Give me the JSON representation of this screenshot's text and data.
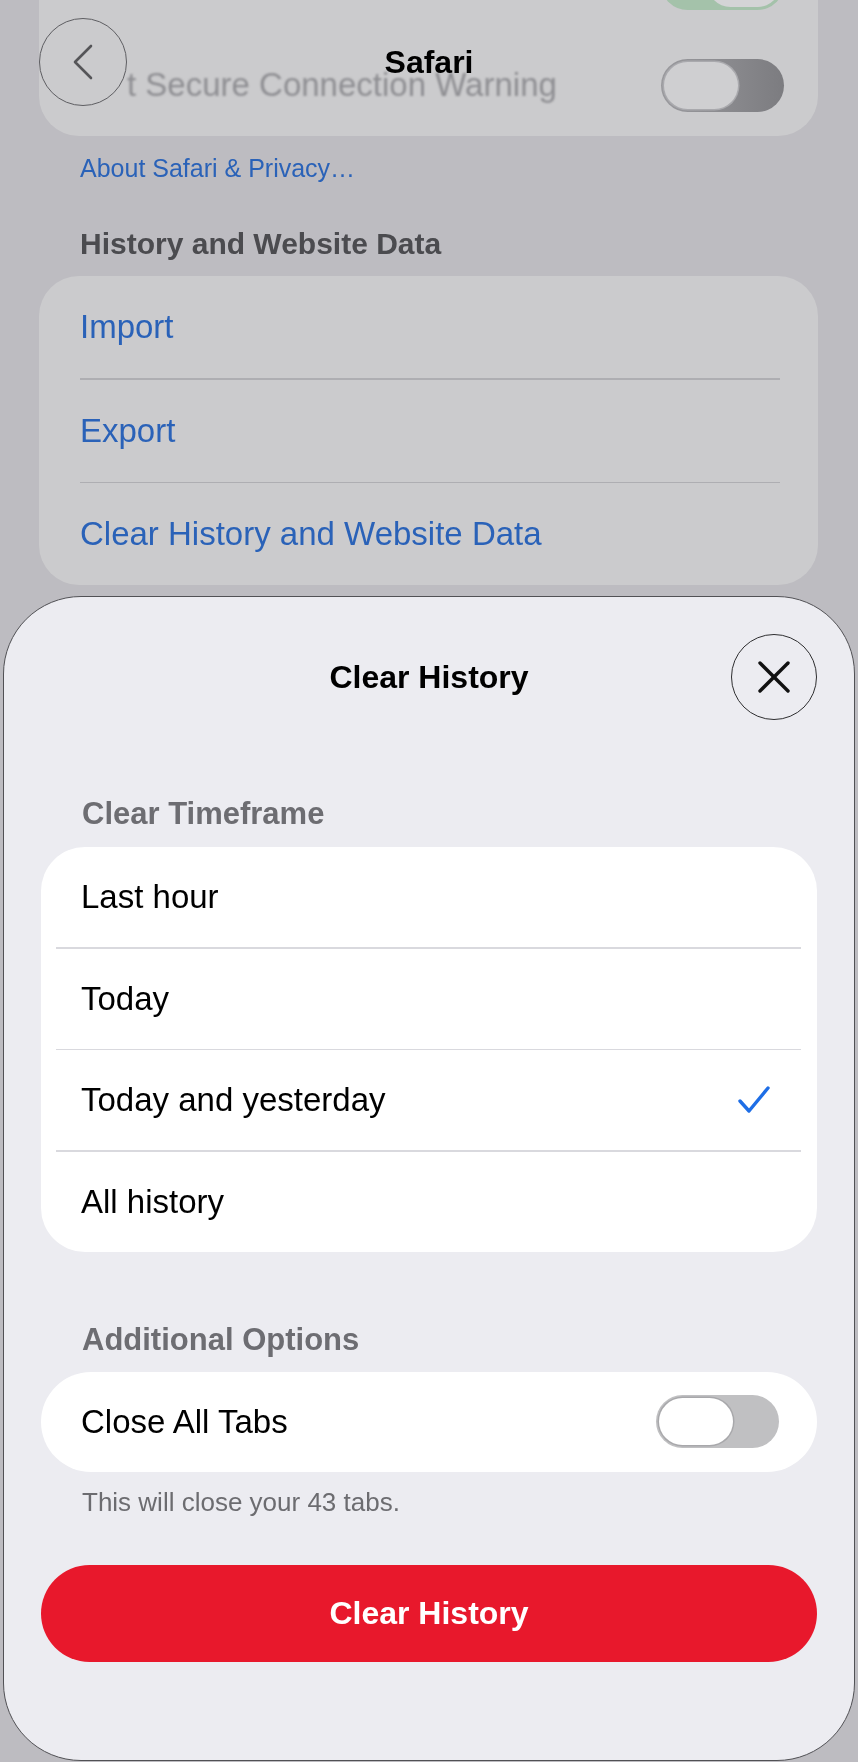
{
  "nav": {
    "title": "Safari"
  },
  "background": {
    "top_card": {
      "rows": [
        {
          "on": true
        },
        {
          "label": "t Secure Connection Warning",
          "on": false
        }
      ]
    },
    "about_link": "About Safari & Privacy…",
    "history_section": {
      "header": "History and Website Data",
      "items": [
        "Import",
        "Export",
        "Clear History and Website Data"
      ]
    }
  },
  "sheet": {
    "title": "Clear History",
    "timeframe": {
      "header": "Clear Timeframe",
      "options": [
        {
          "label": "Last hour",
          "selected": false
        },
        {
          "label": "Today",
          "selected": false
        },
        {
          "label": "Today and yesterday",
          "selected": true
        },
        {
          "label": "All history",
          "selected": false
        }
      ]
    },
    "additional": {
      "header": "Additional Options",
      "options": [
        {
          "label": "Close All Tabs",
          "on": false
        }
      ],
      "footer": "This will close your 43 tabs."
    },
    "action_button": "Clear History"
  }
}
